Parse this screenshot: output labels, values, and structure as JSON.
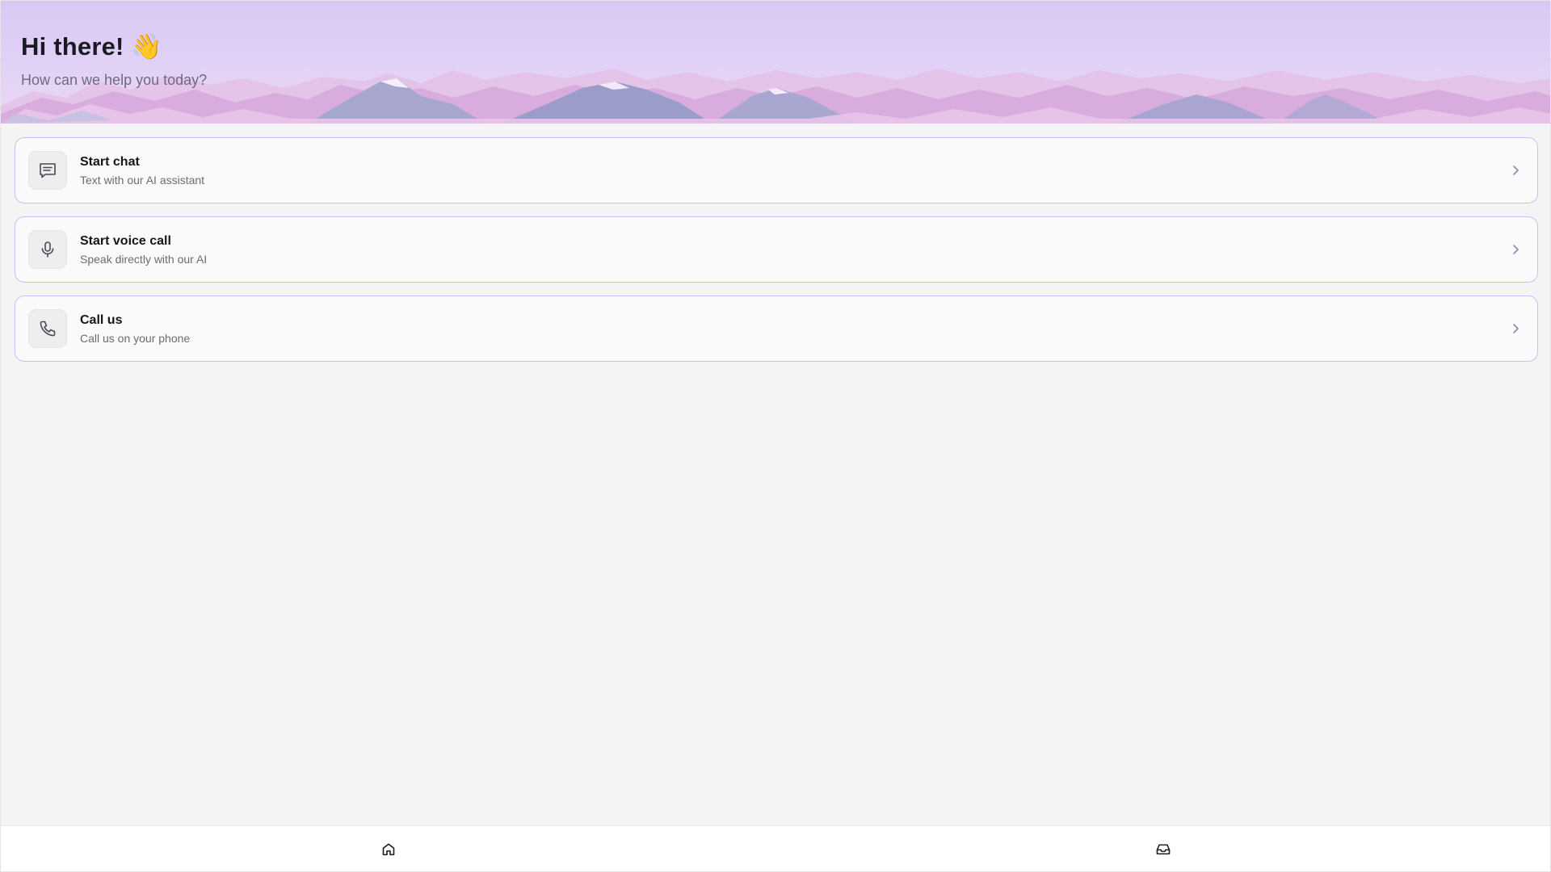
{
  "hero": {
    "title": "Hi there! 👋",
    "subtitle": "How can we help you today?"
  },
  "options": [
    {
      "title": "Start chat",
      "subtitle": "Text with our AI assistant",
      "icon": "chat-icon"
    },
    {
      "title": "Start voice call",
      "subtitle": "Speak directly with our AI",
      "icon": "microphone-icon"
    },
    {
      "title": "Call us",
      "subtitle": "Call us on your phone",
      "icon": "phone-icon"
    }
  ],
  "bottom_nav": {
    "items": [
      {
        "icon": "home-icon"
      },
      {
        "icon": "inbox-icon"
      }
    ]
  },
  "colors": {
    "card_border": "#cdbdf0",
    "hero_gradient_top": "#d8c8f4",
    "background": "#f4f4f4"
  }
}
